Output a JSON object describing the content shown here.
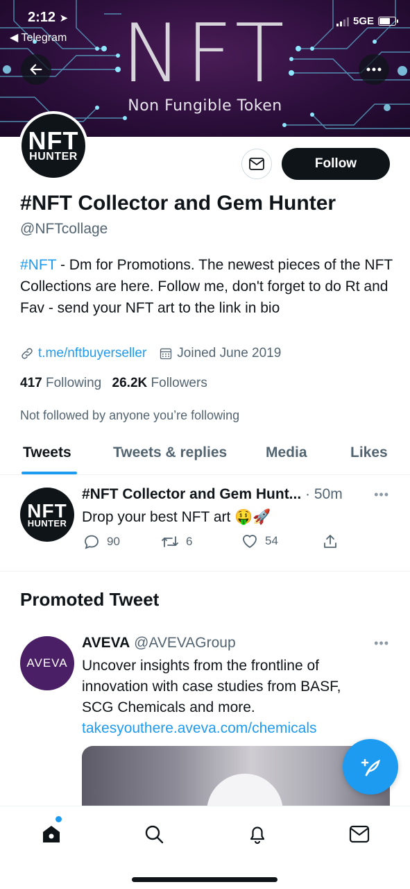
{
  "status_bar": {
    "time": "2:12",
    "back_app": "Telegram",
    "network": "5GE"
  },
  "banner": {
    "logo_text": "NFT",
    "subtitle": "Non Fungible Token"
  },
  "header": {
    "back_icon": "arrow-left-icon",
    "more_icon": "more-horizontal-icon"
  },
  "profile": {
    "avatar_line1": "NFT",
    "avatar_line2": "HUNTER",
    "follow_label": "Follow",
    "display_name": "#NFT Collector and Gem Hunter",
    "handle": "@NFTcollage",
    "bio_hashtag": "#NFT",
    "bio_text": " - Dm for Promotions. The newest pieces of the NFT Collections are here. Follow me, don't forget to do Rt and Fav - send your NFT art to the link in bio",
    "link": "t.me/nftbuyerseller",
    "joined": "Joined June 2019",
    "following_count": "417",
    "following_label": "Following",
    "followers_count": "26.2K",
    "followers_label": "Followers",
    "not_followed": "Not followed by anyone you’re following"
  },
  "tabs": [
    {
      "label": "Tweets",
      "active": true
    },
    {
      "label": "Tweets & replies",
      "active": false
    },
    {
      "label": "Media",
      "active": false
    },
    {
      "label": "Likes",
      "active": false
    }
  ],
  "tweet": {
    "name": "#NFT Collector and Gem Hunt...",
    "time": " · 50m",
    "text": "Drop your best NFT art 🤑🚀",
    "replies": "90",
    "retweets": "6",
    "likes": "54"
  },
  "promoted": {
    "section_title": "Promoted Tweet",
    "avatar_text": "AVEVA",
    "name": "AVEVA",
    "handle": " @AVEVAGroup",
    "text": "Uncover insights from the frontline of innovation with case studies from BASF, SCG Chemicals and more.",
    "link": "takesyouthere.aveva.com/chemicals"
  },
  "bottom_nav": [
    "home-icon",
    "search-icon",
    "notifications-icon",
    "messages-icon"
  ],
  "colors": {
    "accent": "#1d9bf0",
    "text": "#0f1419",
    "secondary": "#536471",
    "banner": "#2d0f3c",
    "aveva": "#4a1f66"
  }
}
